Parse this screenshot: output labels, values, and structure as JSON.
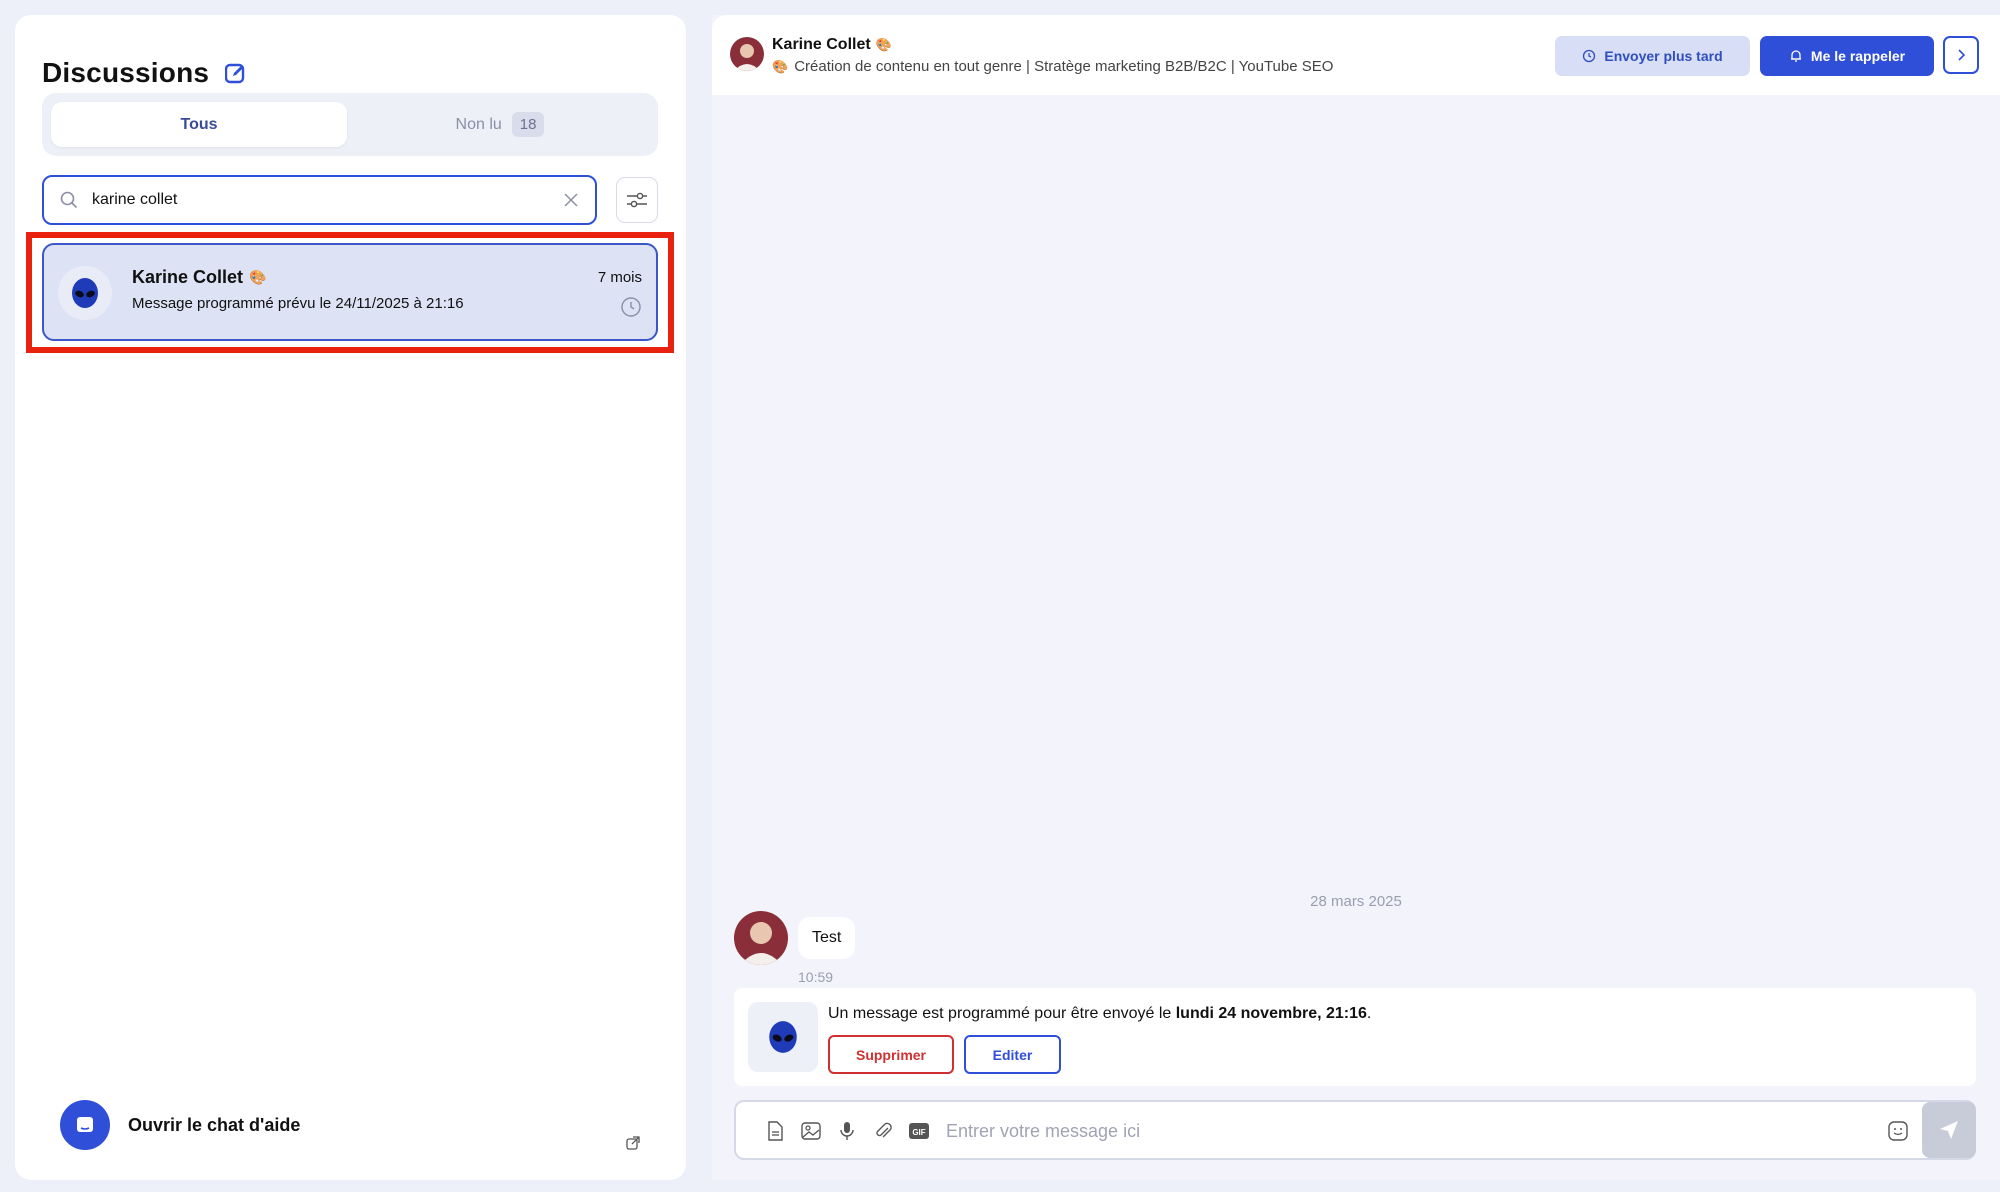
{
  "sidebar": {
    "title": "Discussions",
    "tabs": [
      {
        "label": "Tous",
        "active": true
      },
      {
        "label": "Non lu",
        "count": "18"
      }
    ],
    "search": {
      "value": "karine collet",
      "placeholder": ""
    },
    "conversations": [
      {
        "name": "Karine Collet",
        "emoji": "🎨",
        "preview": "Message programmé prévu le 24/11/2025 à 21:16",
        "time": "7 mois",
        "status_icon": "clock-icon",
        "selected": true
      }
    ],
    "help": {
      "label": "Ouvrir le chat d'aide"
    }
  },
  "chat": {
    "contact_name": "Karine Collet",
    "contact_emoji": "🎨",
    "contact_headline_emoji": "🎨",
    "contact_headline": "Création de contenu en tout genre | Stratège marketing B2B/B2C | YouTube SEO",
    "actions": {
      "send_later": "Envoyer plus tard",
      "remind_me": "Me le rappeler"
    },
    "date_separator": "28 mars 2025",
    "messages": [
      {
        "text": "Test",
        "time": "10:59"
      }
    ],
    "scheduled": {
      "text_prefix": "Un message est programmé pour être envoyé le ",
      "date": "lundi 24 novembre, 21:16",
      "text_suffix": ".",
      "delete_label": "Supprimer",
      "edit_label": "Editer"
    },
    "composer": {
      "placeholder": "Entrer votre message ici",
      "value": ""
    }
  },
  "colors": {
    "accent": "#2f4fd9",
    "highlight_border": "#e8220e",
    "selected_card": "#dde2f5",
    "danger": "#cf3030"
  }
}
